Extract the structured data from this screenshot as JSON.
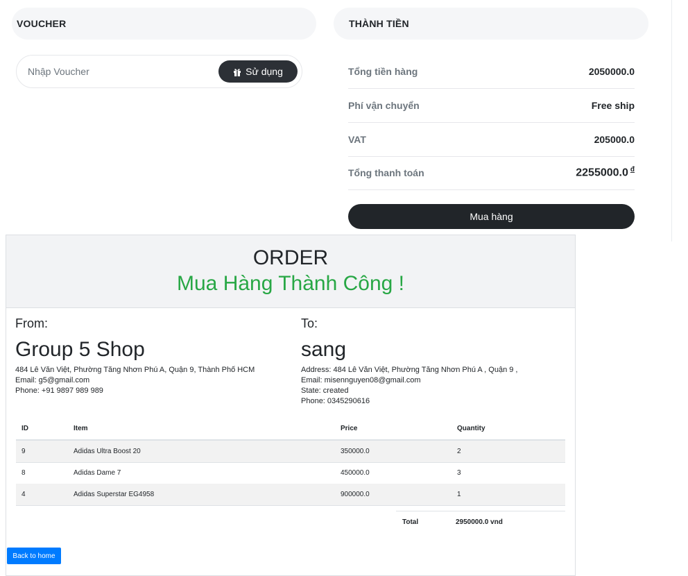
{
  "voucher": {
    "title": "VOUCHER",
    "input_placeholder": "Nhập Voucher",
    "use_label": "Sử dụng"
  },
  "summary": {
    "title": "THÀNH TIỀN",
    "rows": [
      {
        "label": "Tổng tiền hàng",
        "value": "2050000.0"
      },
      {
        "label": "Phí vận chuyển",
        "value": "Free ship"
      },
      {
        "label": "VAT",
        "value": "205000.0"
      },
      {
        "label": "Tổng thanh toán",
        "value": "2255000.0",
        "currency": "đ"
      }
    ],
    "buy_label": "Mua hàng"
  },
  "invoice": {
    "title": "ORDER",
    "success": "Mua Hàng Thành Công !",
    "from": {
      "label": "From:",
      "name": "Group 5 Shop",
      "lines": [
        "484 Lê Văn Việt, Phường Tăng Nhơn Phú A, Quận 9, Thành Phố HCM",
        "Email: g5@gmail.com",
        "Phone: +91 9897 989 989"
      ]
    },
    "to": {
      "label": "To:",
      "name": "sang",
      "lines": [
        "Address: 484 Lê Văn Việt, Phường Tăng Nhơn Phú A , Quận 9 ,",
        "Email: misennguyen08@gmail.com",
        "State: created",
        "Phone: 0345290616"
      ]
    },
    "columns": [
      "ID",
      "Item",
      "Price",
      "Quantity"
    ],
    "rows": [
      {
        "id": "9",
        "item": "Adidas Ultra Boost 20",
        "price": "350000.0",
        "qty": "2"
      },
      {
        "id": "8",
        "item": "Adidas Dame 7",
        "price": "450000.0",
        "qty": "3"
      },
      {
        "id": "4",
        "item": "Adidas Superstar EG4958",
        "price": "900000.0",
        "qty": "1"
      }
    ],
    "total_label": "Total",
    "total_value": "2950000.0 vnd",
    "back_label": "Back to home"
  },
  "colors": {
    "success_green": "#28a745",
    "dark_button": "#212529",
    "primary_blue": "#007bff"
  }
}
